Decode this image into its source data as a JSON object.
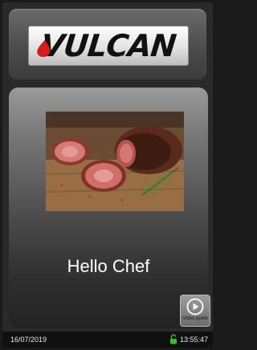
{
  "brand": {
    "name": "VULCAN"
  },
  "main": {
    "greeting": "Hello Chef",
    "image_icon": "roast-beef-image"
  },
  "video_guide": {
    "label": "Video guide",
    "icon": "play-icon"
  },
  "status": {
    "date": "16/07/2019",
    "time": "13:55:47",
    "lock_icon": "unlocked-padlock-icon"
  },
  "colors": {
    "lock": "#2fbf2f",
    "logo_mark": "#d41e1e"
  }
}
